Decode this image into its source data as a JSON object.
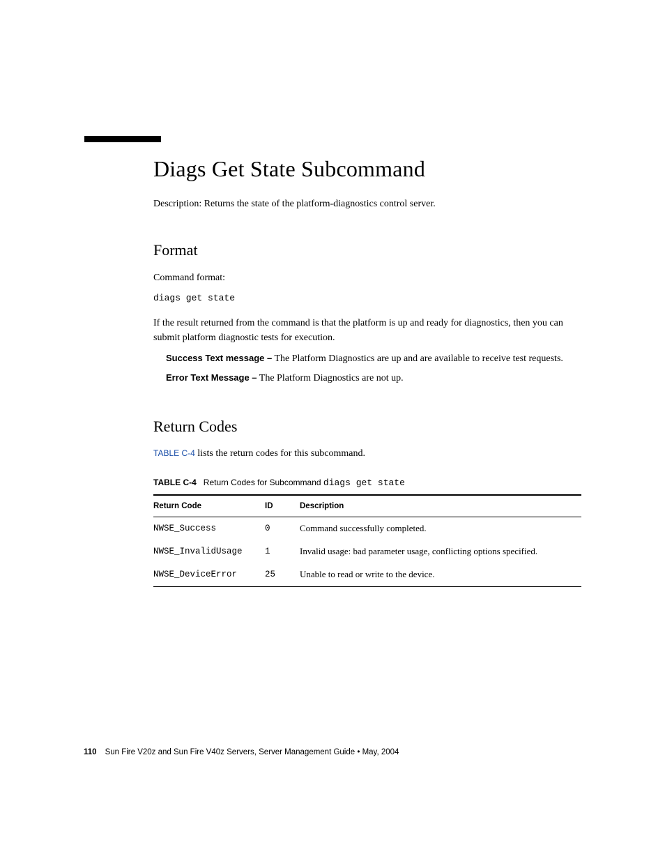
{
  "heading": "Diags Get State Subcommand",
  "description": "Description: Returns the state of the platform-diagnostics control server.",
  "format": {
    "title": "Format",
    "label": "Command format:",
    "command": "diags get state",
    "explain": "If the result returned from the command is that the platform is up and ready for diagnostics, then you can submit platform diagnostic tests for execution.",
    "success_label": "Success Text message –",
    "success_text": " The Platform Diagnostics are up and are available to receive test requests.",
    "error_label": "Error Text Message –",
    "error_text": " The Platform Diagnostics are not up."
  },
  "return_codes": {
    "title": "Return Codes",
    "xref": "TABLE C-4",
    "intro_rest": " lists the return codes for this subcommand.",
    "table_label": "TABLE C-4",
    "table_caption_text": "Return Codes for Subcommand ",
    "table_caption_code": "diags get state",
    "headers": {
      "code": "Return Code",
      "id": "ID",
      "desc": "Description"
    },
    "rows": [
      {
        "code": "NWSE_Success",
        "id": "0",
        "desc": "Command successfully completed."
      },
      {
        "code": "NWSE_InvalidUsage",
        "id": "1",
        "desc": "Invalid usage: bad parameter usage, conflicting options specified."
      },
      {
        "code": "NWSE_DeviceError",
        "id": "25",
        "desc": "Unable to read or write to the device."
      }
    ]
  },
  "footer": {
    "page": "110",
    "text": "Sun Fire V20z and Sun Fire V40z Servers, Server Management Guide • May, 2004"
  }
}
